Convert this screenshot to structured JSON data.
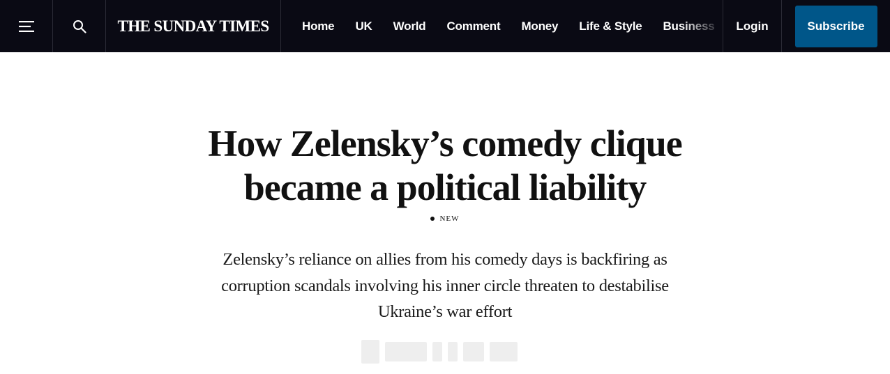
{
  "header": {
    "menu_icon": "hamburger-menu-icon",
    "search_icon": "search-icon",
    "masthead": "THE SUNDAY TIMES",
    "nav_items": [
      "Home",
      "UK",
      "World",
      "Comment",
      "Money",
      "Life & Style",
      "Business"
    ],
    "login_label": "Login",
    "subscribe_label": "Subscribe",
    "colors": {
      "background": "#0a0a14",
      "subscribe": "#005689"
    }
  },
  "article": {
    "headline": "How Zelensky’s comedy clique became a political liability",
    "tag": "NEW",
    "standfirst": "Zelensky’s reliance on allies from his comedy days is backfiring as corruption scandals involving his inner circle threaten to destabilise Ukraine’s war effort"
  }
}
